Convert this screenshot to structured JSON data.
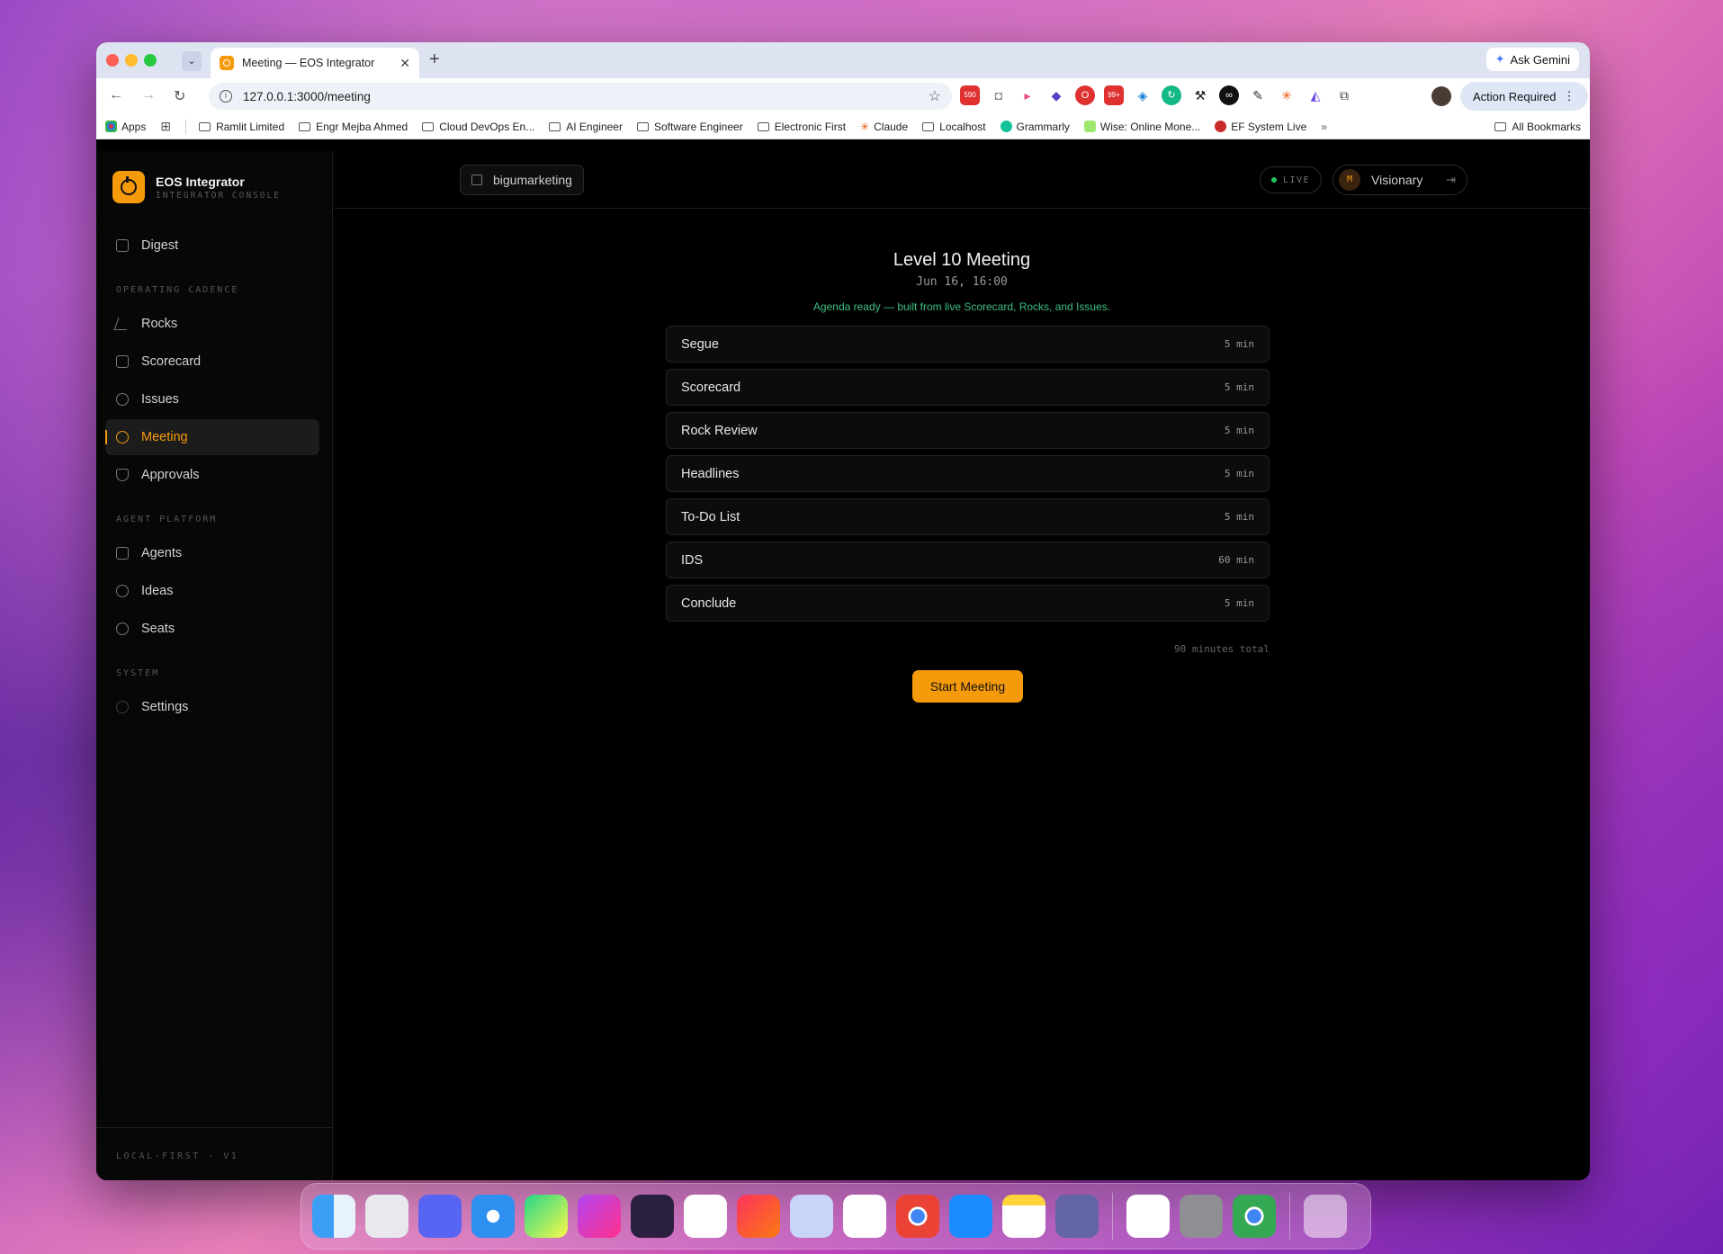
{
  "browser": {
    "tab_title": "Meeting — EOS Integrator",
    "new_tab": "+",
    "ask_gemini": "Ask Gemini",
    "url": "127.0.0.1:3000/meeting",
    "action_required": "Action Required",
    "bookmarks": [
      "Apps",
      "Ramlit Limited",
      "Engr Mejba Ahmed",
      "Cloud DevOps En...",
      "AI Engineer",
      "Software Engineer",
      "Electronic First",
      "Claude",
      "Localhost",
      "Grammarly",
      "Wise: Online Mone...",
      "EF System Live"
    ],
    "bookmarks_more": "»",
    "all_bookmarks": "All Bookmarks",
    "ext_badges": [
      "590",
      "99+"
    ]
  },
  "sidebar": {
    "brand_title": "EOS Integrator",
    "brand_subtitle": "INTEGRATOR CONSOLE",
    "digest": "Digest",
    "section_operating": "OPERATING CADENCE",
    "rocks": "Rocks",
    "scorecard": "Scorecard",
    "issues": "Issues",
    "meeting": "Meeting",
    "approvals": "Approvals",
    "section_agent": "AGENT PLATFORM",
    "agents": "Agents",
    "ideas": "Ideas",
    "seats": "Seats",
    "section_system": "SYSTEM",
    "settings": "Settings",
    "footer": "LOCAL-FIRST · V1"
  },
  "topbar": {
    "org": "bigumarketing",
    "live": "LIVE",
    "avatar_initial": "M",
    "role": "Visionary"
  },
  "meeting": {
    "title": "Level 10 Meeting",
    "date": "Jun 16, 16:00",
    "status": "Agenda ready — built from live Scorecard, Rocks, and Issues.",
    "agenda": [
      {
        "label": "Segue",
        "duration": "5 min"
      },
      {
        "label": "Scorecard",
        "duration": "5 min"
      },
      {
        "label": "Rock Review",
        "duration": "5 min"
      },
      {
        "label": "Headlines",
        "duration": "5 min"
      },
      {
        "label": "To-Do List",
        "duration": "5 min"
      },
      {
        "label": "IDS",
        "duration": "60 min"
      },
      {
        "label": "Conclude",
        "duration": "5 min"
      }
    ],
    "total": "90 minutes total",
    "start_button": "Start Meeting"
  },
  "colors": {
    "accent": "#f59a0b",
    "status_green": "#3fbf7f",
    "live_dot": "#22c55e"
  }
}
